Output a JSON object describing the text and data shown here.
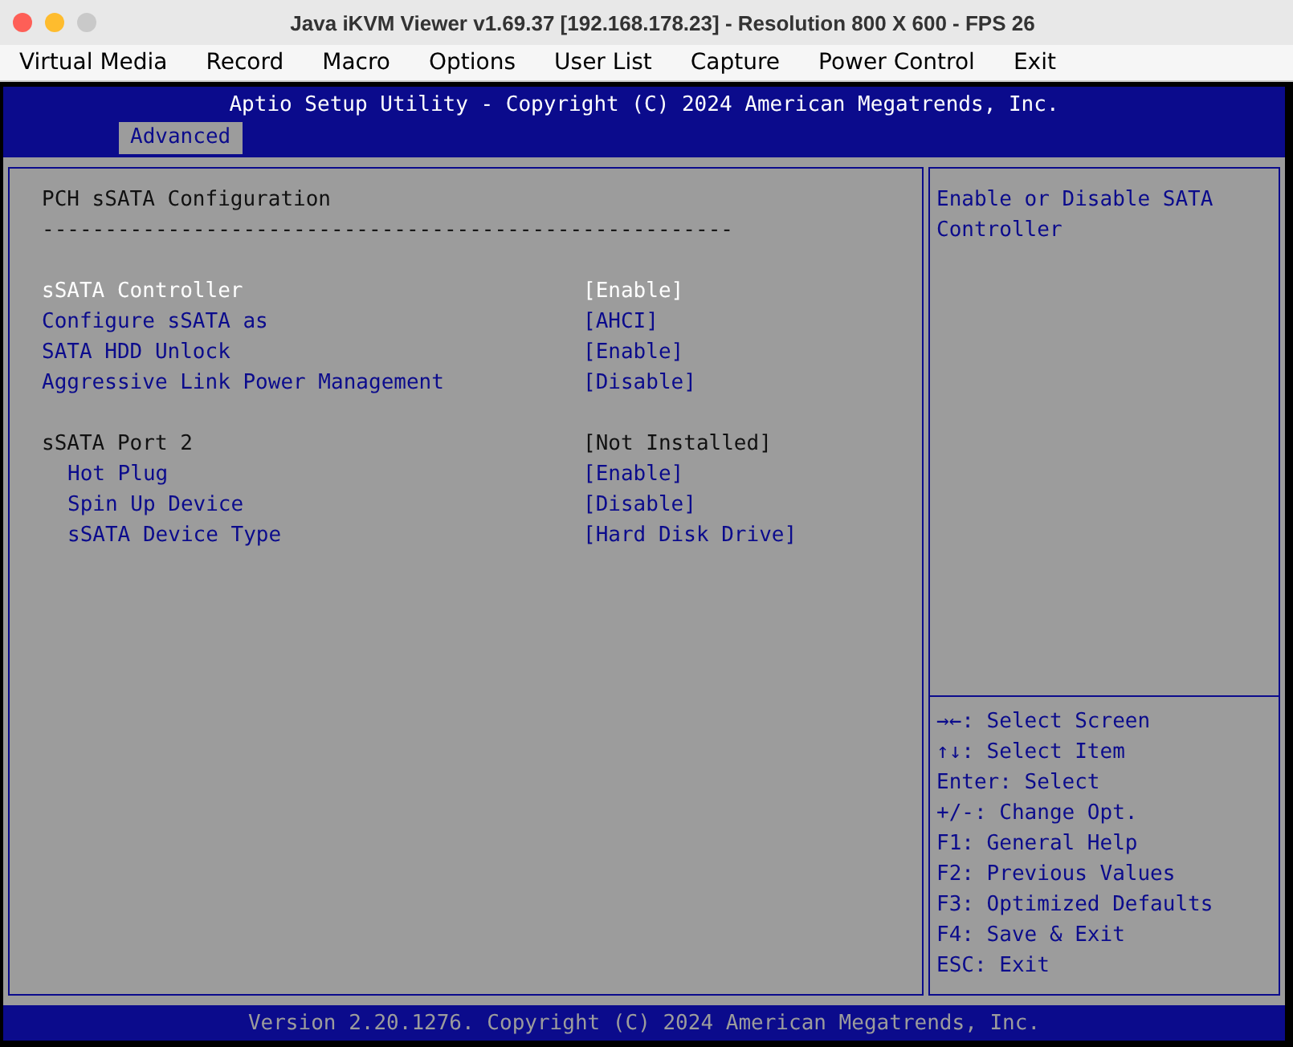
{
  "window": {
    "title": "Java iKVM Viewer v1.69.37 [192.168.178.23]  - Resolution 800 X 600 - FPS 26"
  },
  "menu": [
    "Virtual Media",
    "Record",
    "Macro",
    "Options",
    "User List",
    "Capture",
    "Power Control",
    "Exit"
  ],
  "bios": {
    "title": "Aptio Setup Utility - Copyright (C) 2024 American Megatrends, Inc.",
    "tabs": [
      {
        "label": "Advanced",
        "selected": true
      }
    ],
    "heading": "PCH sSATA Configuration",
    "rule": "-------------------------------------------------------",
    "groups": [
      [
        {
          "label": "sSATA Controller",
          "value": "[Enable]",
          "kind": "setting",
          "selected": true
        },
        {
          "label": "Configure sSATA as",
          "value": "[AHCI]",
          "kind": "setting",
          "selected": false
        },
        {
          "label": "SATA HDD Unlock",
          "value": "[Enable]",
          "kind": "setting",
          "selected": false
        },
        {
          "label": "Aggressive Link Power Management",
          "value": "[Disable]",
          "kind": "setting",
          "selected": false
        }
      ],
      [
        {
          "label": "sSATA Port 2",
          "value": "[Not Installed]",
          "kind": "info",
          "selected": false,
          "children": [
            {
              "label": "Hot Plug",
              "value": "[Enable]",
              "kind": "setting",
              "selected": false
            },
            {
              "label": "Spin Up Device",
              "value": "[Disable]",
              "kind": "setting",
              "selected": false
            },
            {
              "label": "sSATA Device Type",
              "value": "[Hard Disk Drive]",
              "kind": "setting",
              "selected": false
            }
          ]
        }
      ]
    ],
    "help": [
      "Enable or Disable SATA",
      "Controller"
    ],
    "keys": [
      "→←: Select Screen",
      "↑↓: Select Item",
      "Enter: Select",
      "+/-: Change Opt.",
      "F1: General Help",
      "F2: Previous Values",
      "F3: Optimized Defaults",
      "F4: Save & Exit",
      "ESC: Exit"
    ],
    "footer": "Version 2.20.1276. Copyright (C) 2024 American Megatrends, Inc."
  }
}
